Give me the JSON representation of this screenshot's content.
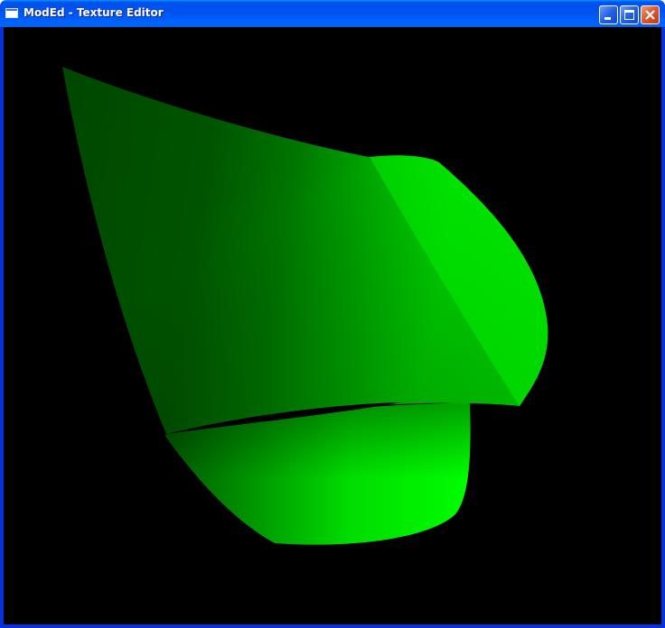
{
  "window": {
    "title": "ModEd - Texture Editor",
    "buttons": {
      "minimize": "minimize-icon",
      "maximize": "maximize-icon",
      "close": "close-icon"
    }
  },
  "viewport": {
    "background": "#000000",
    "object_color": "#00ff00",
    "shade_dark": "#004400"
  }
}
